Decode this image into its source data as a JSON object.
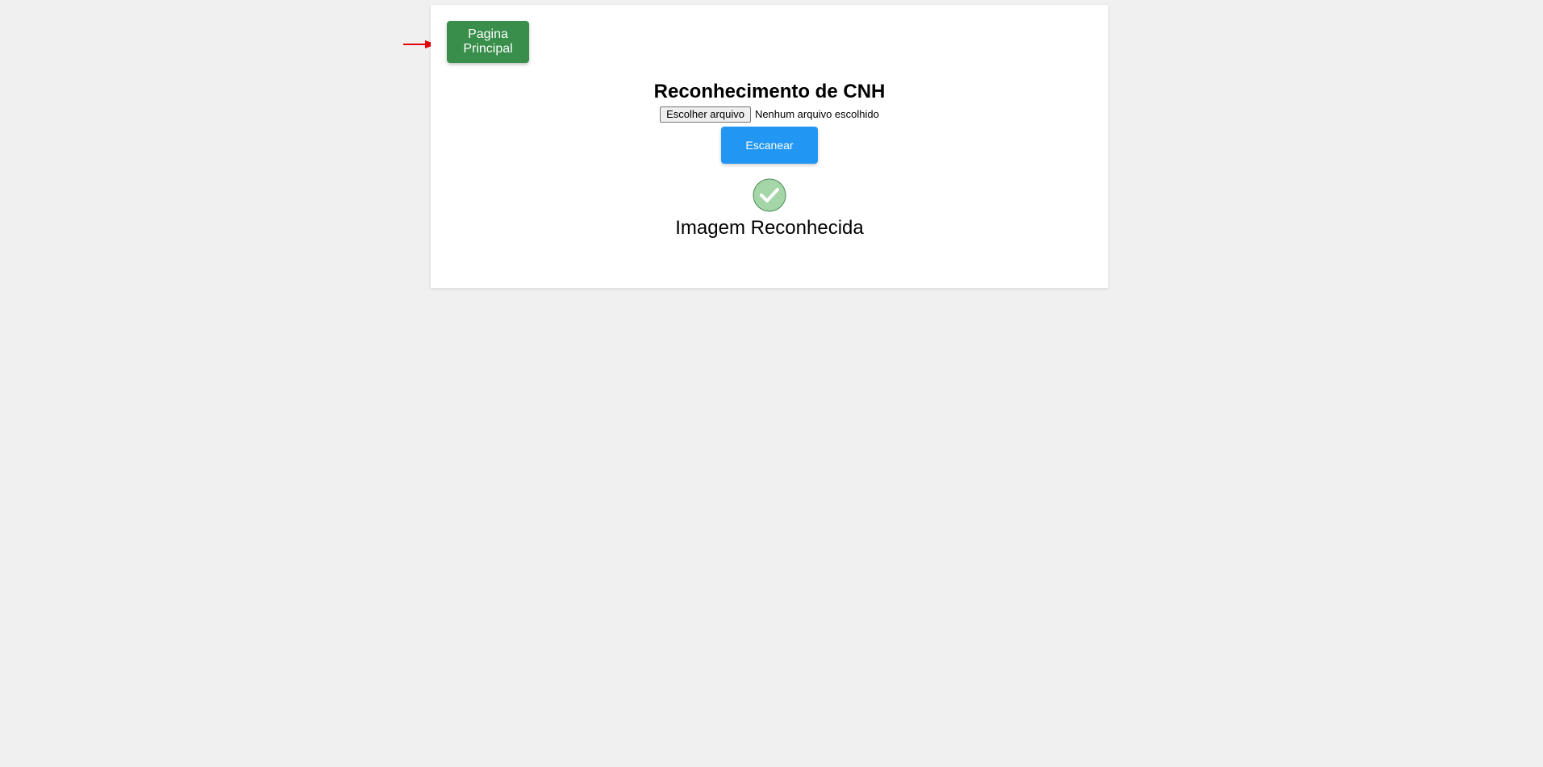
{
  "navigation": {
    "home_button_label": "Pagina Principal"
  },
  "page": {
    "title": "Reconhecimento de CNH"
  },
  "file_input": {
    "button_label": "Escolher arquivo",
    "status": "Nenhum arquivo escolhido"
  },
  "actions": {
    "scan_label": "Escanear"
  },
  "result": {
    "message": "Imagem Reconhecida",
    "icon": "check-circle-icon",
    "icon_color": "#a5d6a7"
  },
  "colors": {
    "home_button": "#388e4a",
    "scan_button": "#2196f3",
    "pointer_arrow": "#e60000",
    "background": "#f0f0f0"
  }
}
